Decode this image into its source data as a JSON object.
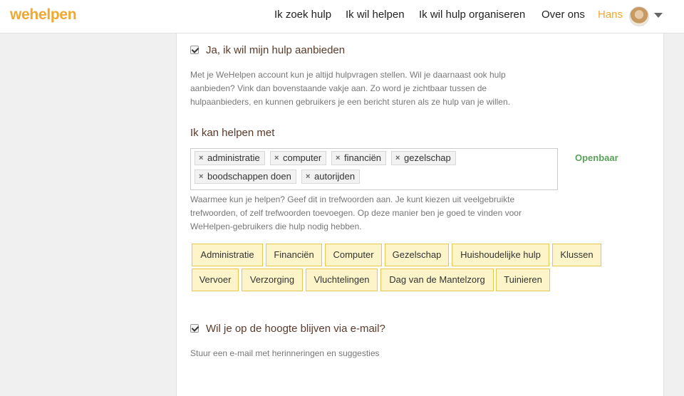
{
  "header": {
    "logo": "wehelpen",
    "nav": [
      "Ik zoek hulp",
      "Ik wil helpen",
      "Ik wil hulp organiseren",
      "Over ons"
    ],
    "user": "Hans"
  },
  "offer_help": {
    "checked": true,
    "label": "Ja, ik wil mijn hulp aanbieden",
    "help_lines": [
      "Met je WeHelpen account kun je altijd hulpvragen stellen. Wil je daarnaast ook hulp",
      "aanbieden? Vink dan bovenstaande vakje aan. Zo word je zichtbaar tussen de",
      "hulpaanbieders, en kunnen gebruikers je een bericht sturen als ze hulp van je willen."
    ]
  },
  "skills": {
    "title": "Ik kan helpen met",
    "tags": [
      "administratie",
      "computer",
      "financiën",
      "gezelschap",
      "boodschappen doen",
      "autorijden"
    ],
    "visibility": "Openbaar",
    "help_lines": [
      "Waarmee kun je helpen? Geef dit in trefwoorden aan. Je kunt kiezen uit veelgebruikte",
      "trefwoorden, of zelf trefwoorden toevoegen. Op deze manier ben je goed te vinden voor",
      "WeHelpen-gebruikers die hulp nodig hebben."
    ],
    "suggestions": [
      "Administratie",
      "Financiën",
      "Computer",
      "Gezelschap",
      "Huishoudelijke hulp",
      "Klussen",
      "Vervoer",
      "Verzorging",
      "Vluchtelingen",
      "Dag van de Mantelzorg",
      "Tuinieren"
    ]
  },
  "email_updates": {
    "checked": true,
    "label": "Wil je op de hoogte blijven via e-mail?",
    "help": "Stuur een e-mail met herinneringen en suggesties"
  },
  "colors": {
    "brand": "#f0a830",
    "label": "#5a3a2a",
    "public": "#5aa05a",
    "chip_bg": "#fdf5c9",
    "chip_border": "#e8c84a"
  }
}
